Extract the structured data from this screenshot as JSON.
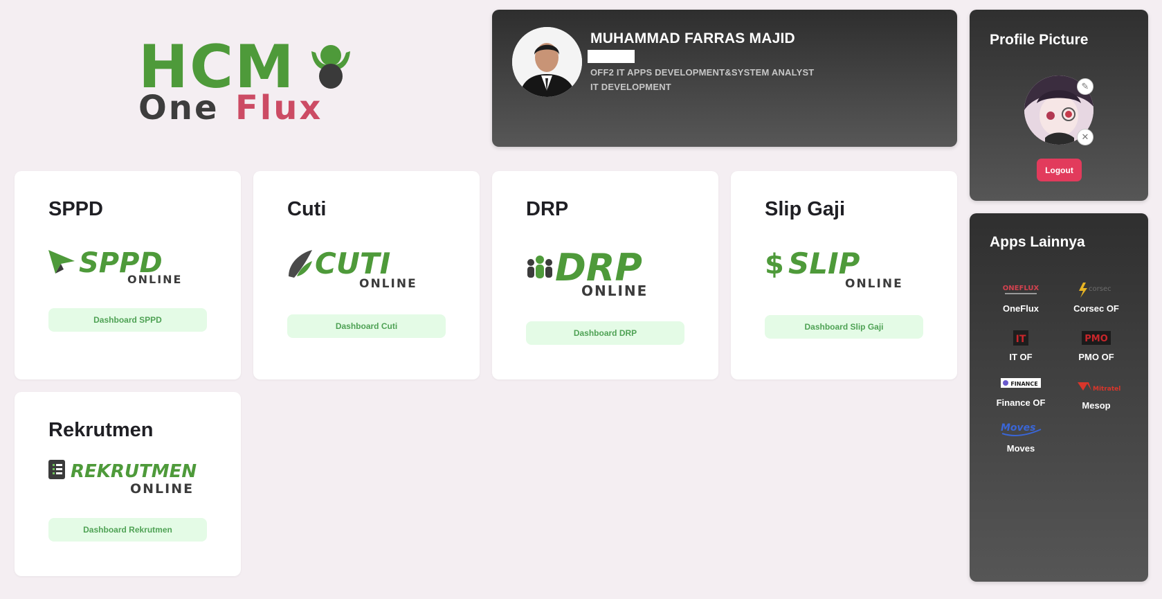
{
  "brand": {
    "logo_top": "HCM",
    "logo_bottom_left": "One",
    "logo_bottom_right": "Flux"
  },
  "profile": {
    "name": "MUHAMMAD FARRAS MAJID",
    "position": "OFF2 IT APPS DEVELOPMENT&SYSTEM ANALYST",
    "department": "IT DEVELOPMENT"
  },
  "profile_picture": {
    "title": "Profile Picture",
    "logout_label": "Logout"
  },
  "modules": [
    {
      "title": "SPPD",
      "logo_word": "SPPD",
      "logo_sub": "ONLINE",
      "button_label": "Dashboard SPPD"
    },
    {
      "title": "Cuti",
      "logo_word": "CUTI",
      "logo_sub": "ONLINE",
      "button_label": "Dashboard Cuti"
    },
    {
      "title": "DRP",
      "logo_word": "DRP",
      "logo_sub": "ONLINE",
      "button_label": "Dashboard DRP"
    },
    {
      "title": "Slip Gaji",
      "logo_word": "SLIP",
      "logo_sub": "ONLINE",
      "button_label": "Dashboard Slip Gaji"
    },
    {
      "title": "Rekrutmen",
      "logo_word": "REKRUTMEN",
      "logo_sub": "ONLINE",
      "button_label": "Dashboard Rekrutmen"
    }
  ],
  "apps": {
    "title": "Apps Lainnya",
    "items": [
      {
        "name": "OneFlux",
        "logo_text": "ONEFLUX",
        "color": "#d2424f"
      },
      {
        "name": "Corsec OF",
        "logo_text": "corsec",
        "color": "#e8b423"
      },
      {
        "name": "IT OF",
        "logo_text": "IT",
        "color": "#c8262b"
      },
      {
        "name": "PMO OF",
        "logo_text": "PMO",
        "color": "#c8262b"
      },
      {
        "name": "Finance OF",
        "logo_text": "FINANCE",
        "color": "#1a1a1a"
      },
      {
        "name": "Mesop",
        "logo_text": "Mitratel",
        "color": "#d9362b"
      },
      {
        "name": "Moves",
        "logo_text": "Moves",
        "color": "#3a66d6"
      }
    ]
  },
  "colors": {
    "accent_green": "#4e9a3a",
    "button_bg": "#e4fbe6",
    "logout_red": "#e23b5c",
    "dark_card": "#2f2f2f"
  }
}
